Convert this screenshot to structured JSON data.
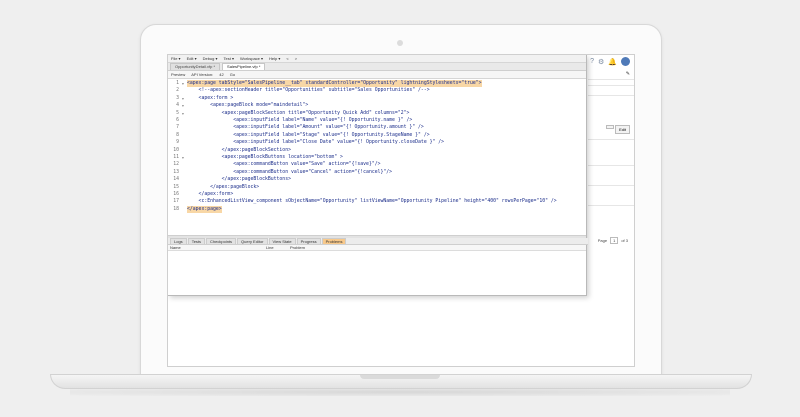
{
  "menu": [
    "File ▾",
    "Edit ▾",
    "Debug ▾",
    "Test ▾",
    "Workspace ▾",
    "Help ▾",
    "<",
    ">"
  ],
  "file_tabs": [
    {
      "label": "OpportunityDetail.vfp *",
      "active": false
    },
    {
      "label": "SalesPipeline.vfp *",
      "active": true
    }
  ],
  "toolbar": {
    "preview": "Preview",
    "api_version_label": "API Version:",
    "api_version_value": "42",
    "go": "Go"
  },
  "code_lines": [
    {
      "n": "1",
      "fold": "▾",
      "text": "<apex:page tabStyle=\"SalesPipeline__tab\" standardController=\"Opportunity\" lightningStylesheets=\"true\">",
      "hl": true
    },
    {
      "n": "2",
      "fold": "",
      "text": "    <!--apex:sectionHeader title=\"Opportunities\" subtitle=\"Sales Opportunities\" /-->",
      "hl": false
    },
    {
      "n": "3",
      "fold": "▾",
      "text": "    <apex:form >",
      "hl": false
    },
    {
      "n": "4",
      "fold": "▾",
      "text": "        <apex:pageBlock mode=\"maindetail\">",
      "hl": false
    },
    {
      "n": "5",
      "fold": "▾",
      "text": "            <apex:pageBlockSection title=\"Opportunity Quick Add\" columns=\"2\">",
      "hl": false
    },
    {
      "n": "6",
      "fold": "",
      "text": "                <apex:inputField label=\"Name\" value=\"{! Opportunity.name }\" />",
      "hl": false
    },
    {
      "n": "7",
      "fold": "",
      "text": "                <apex:inputField label=\"Amount\" value=\"{! Opportunity.amount }\" />",
      "hl": false
    },
    {
      "n": "8",
      "fold": "",
      "text": "                <apex:inputField label=\"Stage\" value=\"{! Opportunity.StageName }\" />",
      "hl": false
    },
    {
      "n": "9",
      "fold": "",
      "text": "                <apex:inputField label=\"Close Date\" value=\"{! Opportunity.closeDate }\" />",
      "hl": false
    },
    {
      "n": "10",
      "fold": "",
      "text": "            </apex:pageBlockSection>",
      "hl": false
    },
    {
      "n": "11",
      "fold": "▾",
      "text": "            <apex:pageBlockButtons location=\"bottom\" >",
      "hl": false
    },
    {
      "n": "12",
      "fold": "",
      "text": "                <apex:commandButton value=\"Save\" action=\"{!save}\"/>",
      "hl": false
    },
    {
      "n": "13",
      "fold": "",
      "text": "                <apex:commandButton value=\"Cancel\" action=\"{!cancel}\"/>",
      "hl": false
    },
    {
      "n": "14",
      "fold": "",
      "text": "            </apex:pageBlockButtons>",
      "hl": false
    },
    {
      "n": "15",
      "fold": "",
      "text": "        </apex:pageBlock>",
      "hl": false
    },
    {
      "n": "16",
      "fold": "",
      "text": "    </apex:form>",
      "hl": false
    },
    {
      "n": "17",
      "fold": "",
      "text": "    <c:EnhancedListView_component sObjectName=\"Opportunity\" listViewName=\"Opportunity Pipeline\" height=\"400\" rowsPerPage=\"10\" />",
      "hl": false
    },
    {
      "n": "18",
      "fold": "",
      "text": "</apex:page>",
      "hl": true
    }
  ],
  "panel_tabs": [
    {
      "label": "Logs",
      "active": false
    },
    {
      "label": "Tests",
      "active": false
    },
    {
      "label": "Checkpoints",
      "active": false
    },
    {
      "label": "Query Editor",
      "active": false
    },
    {
      "label": "View State",
      "active": false
    },
    {
      "label": "Progress",
      "active": false
    },
    {
      "label": "Problems",
      "active": true
    }
  ],
  "problems_columns": [
    "Name",
    "Line",
    "Problem"
  ],
  "bg": {
    "icons": [
      "?",
      "gear-icon",
      "bell-icon",
      "avatar"
    ],
    "edit_button": "Edit",
    "pager_page_label": "Page",
    "pager_page_value": "1",
    "pager_of": "of 3"
  },
  "colors": {
    "highlight": "#f8d7a6",
    "active_panel_tab": "#f8c98b",
    "code_text": "#1b2d8a"
  }
}
